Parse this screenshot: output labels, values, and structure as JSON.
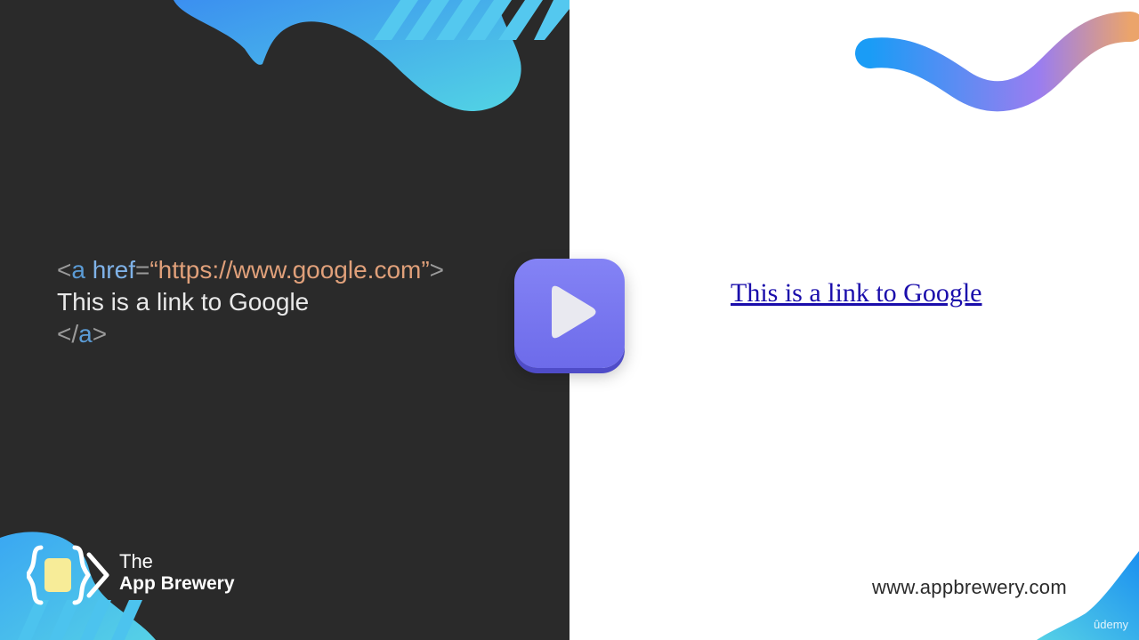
{
  "code_panel": {
    "line1": {
      "open_bracket": "<",
      "tag": "a",
      "space": " ",
      "attr": "href",
      "equals": "=",
      "value": "“https://www.google.com”",
      "close_bracket": ">"
    },
    "line2": "This is a link to Google",
    "line3": {
      "open_bracket": "</",
      "tag": "a",
      "close_bracket": ">"
    }
  },
  "play_button": {
    "icon": "play-icon"
  },
  "brand": {
    "logo_icon": "app-brewery-logo-icon",
    "line1": "The",
    "line2": "App Brewery"
  },
  "preview": {
    "link_text": "This is a link to Google"
  },
  "footer": {
    "website": "www.appbrewery.com",
    "watermark": "ûdemy"
  },
  "colors": {
    "left_background": "#2a2a2a",
    "accent_gradient_start": "#1aa0f5",
    "accent_gradient_end": "#e89a6a",
    "play_button": "#7b79f0",
    "link": "#1a0dab"
  }
}
